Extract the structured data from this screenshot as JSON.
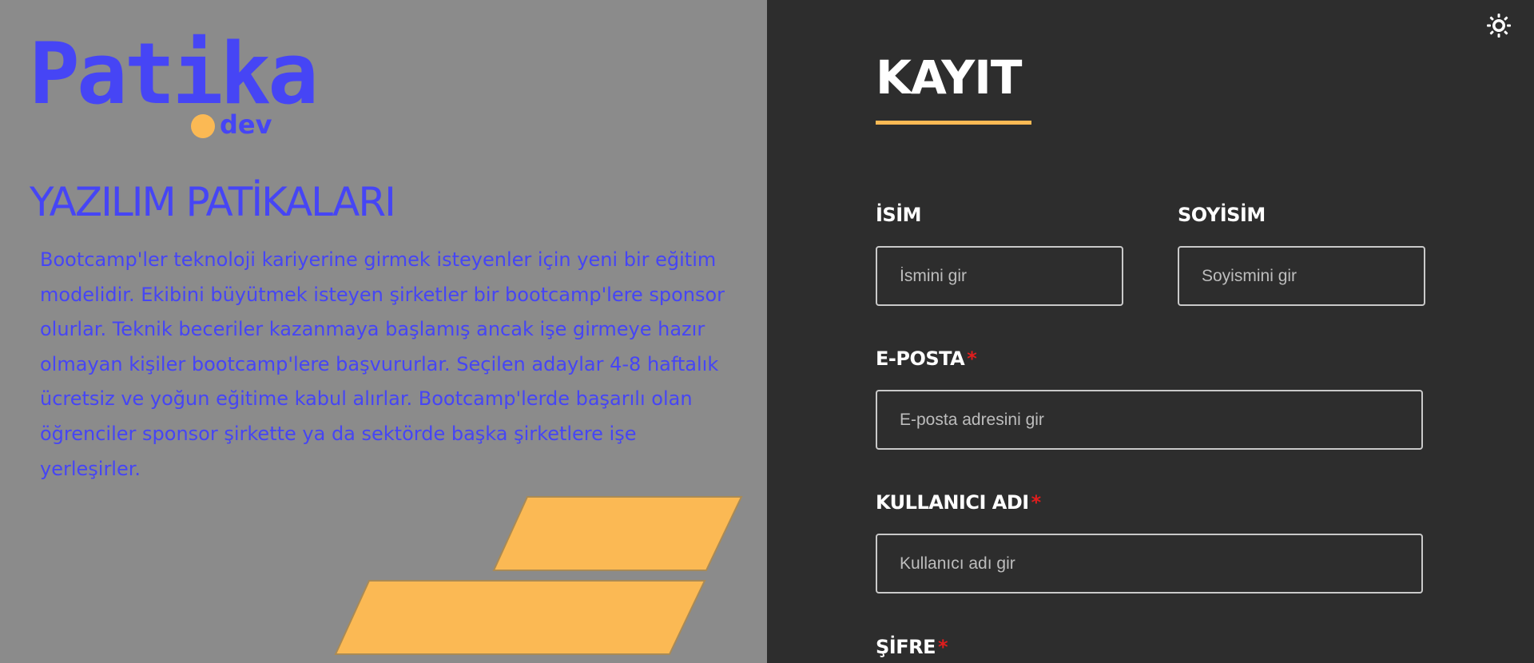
{
  "brand": {
    "logo_word": "Patika",
    "logo_sub": "dev",
    "accent_color": "#fbb954",
    "brand_color": "#4645f5"
  },
  "left": {
    "title": "YAZILIM PATİKALARI",
    "description": "Bootcamp'ler teknoloji kariyerine girmek isteyenler için yeni bir eğitim modelidir. Ekibini büyütmek isteyen şirketler bir bootcamp'lere sponsor olurlar. Teknik beceriler kazanmaya başlamış ancak işe girmeye hazır olmayan kişiler bootcamp'lere başvururlar. Seçilen adaylar 4-8 haftalık ücretsiz ve yoğun eğitime kabul alırlar. Bootcamp'lerde başarılı olan öğrenciler sponsor şirkette ya da sektörde başka şirketlere işe yerleşirler."
  },
  "header": {
    "theme_toggle_icon": "sun-icon"
  },
  "form": {
    "title": "KAYIT",
    "fields": {
      "first_name": {
        "label": "İSİM",
        "placeholder": "İsmini gir",
        "required_mark": ""
      },
      "last_name": {
        "label": "SOYİSİM",
        "placeholder": "Soyismini gir",
        "required_mark": ""
      },
      "email": {
        "label": "E-POSTA",
        "placeholder": "E-posta adresini gir",
        "required_mark": "*"
      },
      "username": {
        "label": "KULLANICI ADI",
        "placeholder": "Kullanıcı adı gir",
        "required_mark": "*"
      },
      "password": {
        "label": "ŞİFRE",
        "required_mark": "*"
      }
    }
  }
}
